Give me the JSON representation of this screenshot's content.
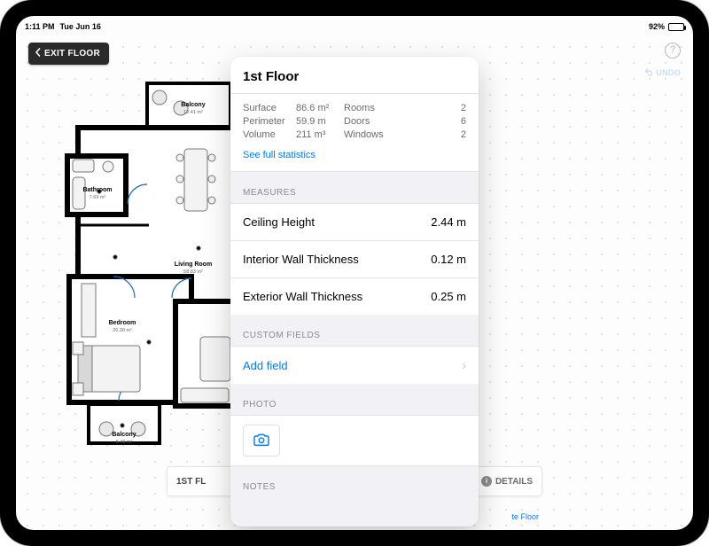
{
  "status": {
    "time": "1:11 PM",
    "date": "Tue Jun 16",
    "battery_pct": "92%"
  },
  "toolbar": {
    "exit_label": "EXIT FLOOR",
    "undo_label": "UNDO",
    "help_glyph": "?"
  },
  "bottombar": {
    "floor_tab": "1ST FL",
    "details_label": "DETAILS",
    "duplicate_label": "te Floor"
  },
  "floorplan": {
    "rooms": [
      {
        "name": "Balcony",
        "area": "12.41 m²"
      },
      {
        "name": "Bathroom",
        "area": "7.69 m²"
      },
      {
        "name": "Living Room",
        "area": "58.83 m²"
      },
      {
        "name": "Bedroom",
        "area": "20.30 m²"
      },
      {
        "name": "Balcony",
        "area": "6.49 m²"
      }
    ]
  },
  "panel": {
    "title": "1st Floor",
    "stats": {
      "surface_label": "Surface",
      "surface_value": "86.6 m²",
      "perimeter_label": "Perimeter",
      "perimeter_value": "59.9 m",
      "volume_label": "Volume",
      "volume_value": "211 m³",
      "rooms_label": "Rooms",
      "rooms_value": "2",
      "doors_label": "Doors",
      "doors_value": "6",
      "windows_label": "Windows",
      "windows_value": "2",
      "see_full": "See full statistics"
    },
    "measures_header": "MEASURES",
    "measures": [
      {
        "label": "Ceiling Height",
        "value": "2.44 m"
      },
      {
        "label": "Interior Wall Thickness",
        "value": "0.12 m"
      },
      {
        "label": "Exterior Wall Thickness",
        "value": "0.25 m"
      }
    ],
    "custom_header": "CUSTOM FIELDS",
    "add_field_label": "Add field",
    "photo_header": "PHOTO",
    "notes_header": "NOTES"
  }
}
